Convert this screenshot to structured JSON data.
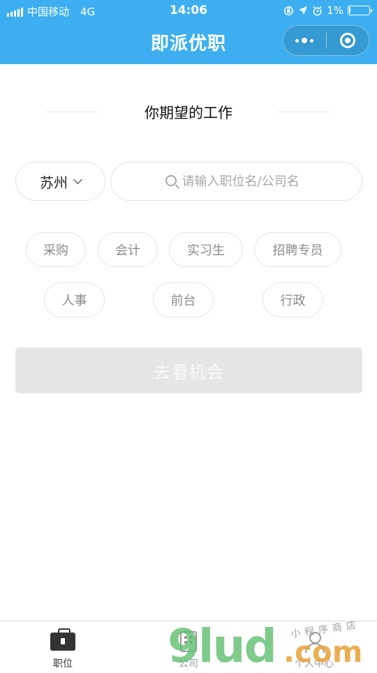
{
  "status_bar": {
    "carrier": "中国移动",
    "network": "4G",
    "time": "14:06",
    "battery": "1%",
    "icons": [
      "signal-icon",
      "lock-rotation-icon",
      "location-icon",
      "alarm-icon",
      "battery-icon"
    ]
  },
  "nav": {
    "title": "即派优职",
    "capsule": [
      "more-icon",
      "close-target-icon"
    ]
  },
  "section": {
    "title": "你期望的工作"
  },
  "filter": {
    "city": "苏州",
    "search_placeholder": "请输入职位名/公司名",
    "search_value": ""
  },
  "tags": [
    "采购",
    "会计",
    "实习生",
    "招聘专员",
    "人事",
    "前台",
    "行政"
  ],
  "submit": {
    "label": "去看机会",
    "enabled": false
  },
  "tabbar": {
    "tabs": [
      {
        "label": "职位",
        "icon": "briefcase-icon",
        "active": true
      },
      {
        "label": "公司",
        "icon": "building-icon",
        "active": false
      },
      {
        "label": "个人中心",
        "icon": "person-icon",
        "active": false
      }
    ]
  },
  "watermark": {
    "brand": "9lud",
    "suffix": ".com",
    "tagline": "小程序商店"
  },
  "colors": {
    "header": "#3daff0",
    "active_tab": "#333333",
    "inactive_tab": "#999999",
    "button_disabled": "#e6e6e6"
  }
}
